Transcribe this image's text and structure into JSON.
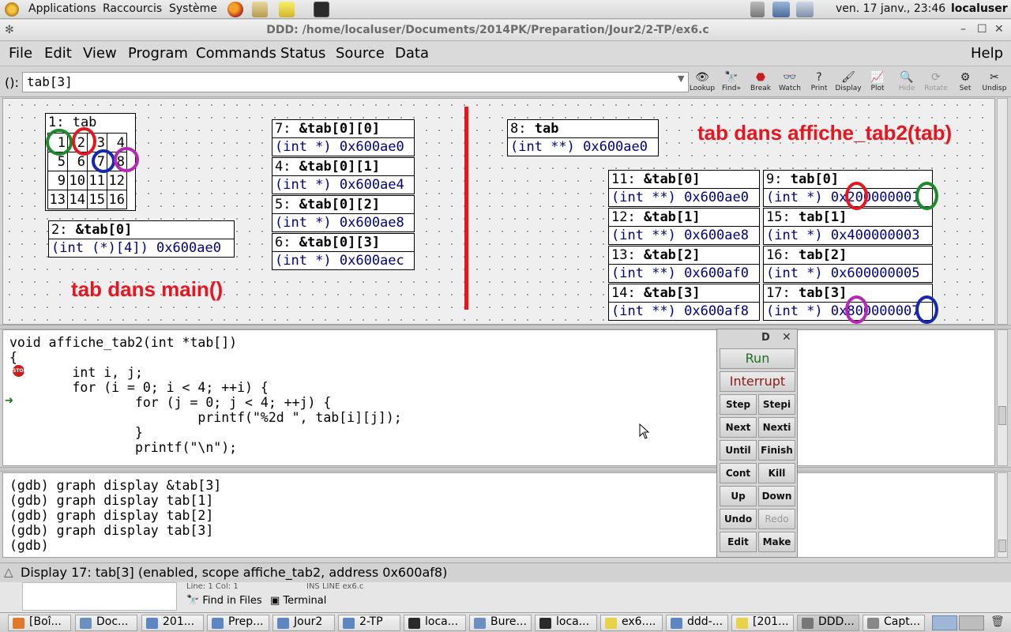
{
  "top_panel": {
    "items": [
      "Applications",
      "Raccourcis",
      "Système"
    ],
    "clock": "ven. 17 janv., 23:46",
    "user": "localuser",
    "launcher_icons": [
      "firefox-icon",
      "archive-icon",
      "text-editor-icon",
      "terminal-icon"
    ],
    "tray_icons": [
      "volume-icon",
      "network-icon",
      "printer-icon"
    ]
  },
  "window": {
    "title": "DDD: /home/localuser/Documents/2014PK/Preparation/Jour2/2-TP/ex6.c",
    "controls": {
      "minimize": "–",
      "maximize": "☐",
      "close": "✕"
    }
  },
  "menubar": {
    "items": [
      "File",
      "Edit",
      "View",
      "Program",
      "Commands",
      "Status",
      "Source",
      "Data"
    ],
    "help": "Help"
  },
  "argbar": {
    "label": "():",
    "value": "tab[3]"
  },
  "toolbar": [
    {
      "label": "Lookup",
      "icon": "lookup-icon",
      "enabled": true
    },
    {
      "label": "Find»",
      "icon": "find-icon",
      "enabled": true
    },
    {
      "label": "Break",
      "icon": "stop-sign-icon",
      "enabled": true
    },
    {
      "label": "Watch",
      "icon": "watch-icon",
      "enabled": true
    },
    {
      "label": "Print",
      "icon": "print-icon",
      "enabled": true
    },
    {
      "label": "Display",
      "icon": "display-icon",
      "enabled": true
    },
    {
      "label": "Plot",
      "icon": "plot-icon",
      "enabled": true
    },
    {
      "label": "Hide",
      "icon": "hide-icon",
      "enabled": false
    },
    {
      "label": "Rotate",
      "icon": "rotate-icon",
      "enabled": false
    },
    {
      "label": "Set",
      "icon": "set-icon",
      "enabled": true
    },
    {
      "label": "Undisp",
      "icon": "undisp-icon",
      "enabled": true
    }
  ],
  "graph": {
    "matrix_display": {
      "header": "1: tab",
      "rows": [
        [
          "1",
          "2",
          "3",
          "4"
        ],
        [
          "5",
          "6",
          "7",
          "8"
        ],
        [
          "9",
          "10",
          "11",
          "12"
        ],
        [
          "13",
          "14",
          "15",
          "16"
        ]
      ]
    },
    "displays": [
      {
        "num": "2:",
        "expr": "&tab[0]",
        "value": "(int (*)[4]) 0x600ae0"
      },
      {
        "num": "7:",
        "expr": "&tab[0][0]",
        "value": "(int *) 0x600ae0"
      },
      {
        "num": "4:",
        "expr": "&tab[0][1]",
        "value": "(int *) 0x600ae4"
      },
      {
        "num": "5:",
        "expr": "&tab[0][2]",
        "value": "(int *) 0x600ae8"
      },
      {
        "num": "6:",
        "expr": "&tab[0][3]",
        "value": "(int *) 0x600aec"
      },
      {
        "num": "8:",
        "expr": "tab",
        "value": "(int **) 0x600ae0"
      },
      {
        "num": "11:",
        "expr": "&tab[0]",
        "value": "(int **) 0x600ae0"
      },
      {
        "num": "12:",
        "expr": "&tab[1]",
        "value": "(int **) 0x600ae8"
      },
      {
        "num": "13:",
        "expr": "&tab[2]",
        "value": "(int **) 0x600af0"
      },
      {
        "num": "14:",
        "expr": "&tab[3]",
        "value": "(int **) 0x600af8"
      },
      {
        "num": "9:",
        "expr": "tab[0]",
        "value": "(int *) 0x200000001"
      },
      {
        "num": "15:",
        "expr": "tab[1]",
        "value": "(int *) 0x400000003"
      },
      {
        "num": "16:",
        "expr": "tab[2]",
        "value": "(int *) 0x600000005"
      },
      {
        "num": "17:",
        "expr": "tab[3]",
        "value": "(int *) 0x800000007"
      }
    ],
    "annotations": {
      "main_label": "tab dans main()",
      "func_label": "tab dans affiche_tab2(tab)"
    }
  },
  "source": {
    "lines": [
      "void affiche_tab2(int *tab[])",
      "{",
      "        int i, j;",
      "        for (i = 0; i < 4; ++i) {",
      "                for (j = 0; j < 4; ++j) {",
      "                        printf(\"%2d \", tab[i][j]);",
      "                }",
      "                printf(\"\\n\");"
    ],
    "stop_glyph": "STOP"
  },
  "console": {
    "lines": [
      "(gdb) graph display &tab[3]",
      "(gdb) graph display tab[1]",
      "(gdb) graph display tab[2]",
      "(gdb) graph display tab[3]",
      "(gdb)"
    ]
  },
  "command_tool": {
    "title": "D",
    "close": "✕",
    "run": "Run",
    "interrupt": "Interrupt",
    "buttons": [
      [
        "Step",
        "Stepi"
      ],
      [
        "Next",
        "Nexti"
      ],
      [
        "Until",
        "Finish"
      ],
      [
        "Cont",
        "Kill"
      ],
      [
        "Up",
        "Down"
      ],
      [
        "Undo",
        "Redo"
      ],
      [
        "Edit",
        "Make"
      ]
    ],
    "colors": {
      "run": "#1e6e1e",
      "interrupt": "#8b1a1a"
    }
  },
  "status": {
    "text": "Display 17: tab[3] (enabled, scope affiche_tab2, address 0x600af8)"
  },
  "behind_window": {
    "line_col": "Line: 1 Col: 1",
    "ins": "INS   LINE   ex6.c",
    "tabs": [
      "Find in Files",
      "Terminal"
    ]
  },
  "taskbar": {
    "tasks": [
      "[Boî...",
      "Doc...",
      "201...",
      "Prep...",
      "Jour2",
      "2-TP",
      "loca...",
      "Bure...",
      "loca...",
      "ex6....",
      "ddd-...",
      "[201...",
      "DDD...",
      "Capt..."
    ]
  },
  "colors": {
    "highlight_red": "#e8141e",
    "ring_green": "#1a8a2a",
    "ring_red": "#e8141e",
    "ring_blue": "#1428b4",
    "ring_purple": "#b428b4",
    "value_blue": "#000080"
  }
}
